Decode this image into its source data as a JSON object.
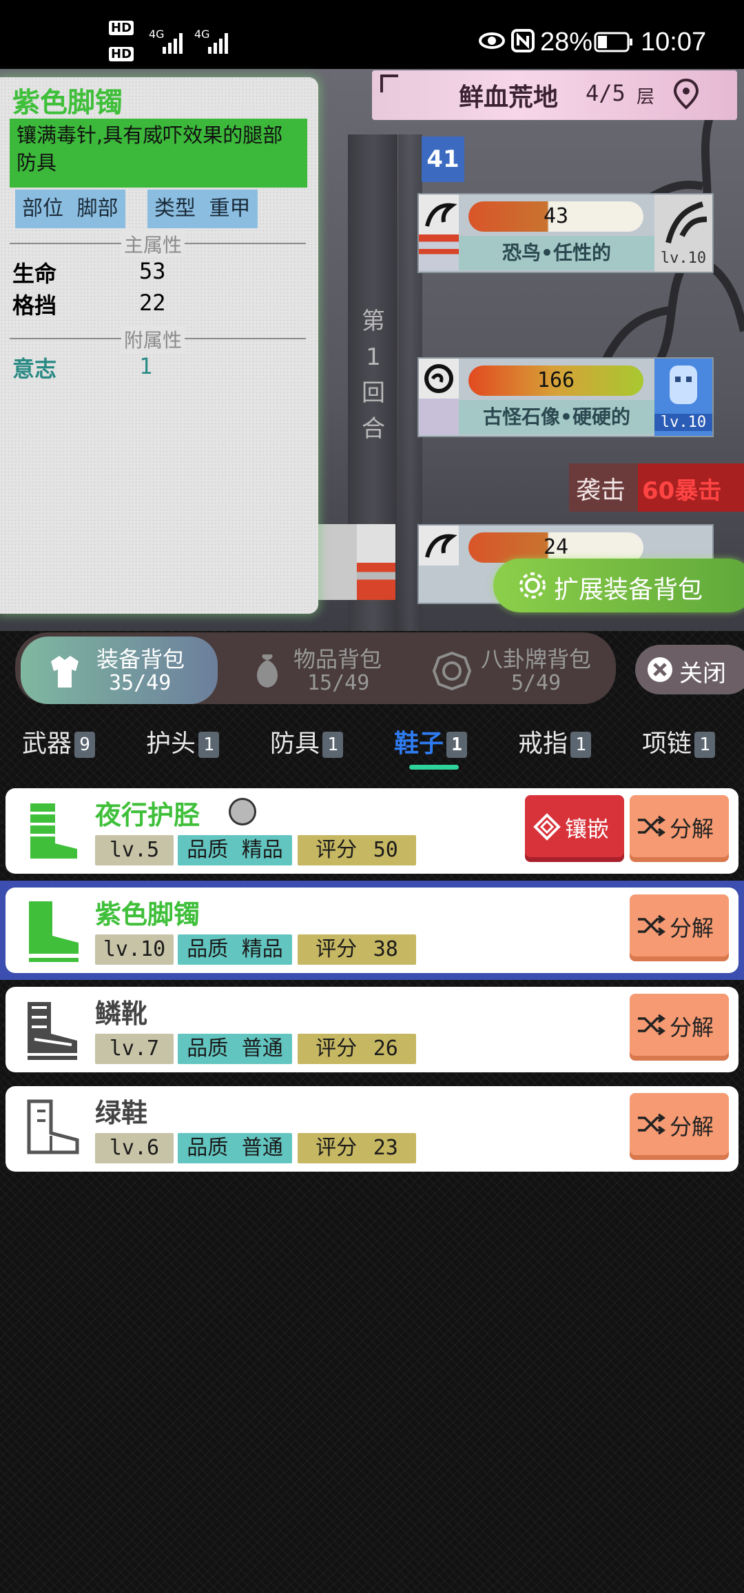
{
  "status_bar": {
    "hd1": "HD",
    "hd2": "HD",
    "net1": "4G",
    "net2": "4G",
    "battery_percent": "28%",
    "time": "10:07"
  },
  "scene": {
    "map_name": "鲜血荒地",
    "floor": "4/5",
    "floor_unit": "层",
    "turn_badge": "41",
    "round_text": "第\n1\n回\n合",
    "enemies": [
      {
        "hp": "43",
        "name": "恐鸟•任性的",
        "level": "lv.10"
      },
      {
        "hp": "166",
        "name": "古怪石像•硬硬的",
        "level": "lv.10"
      },
      {
        "hp": "24",
        "name": "",
        "level": ""
      }
    ],
    "attack_label": "袭击",
    "crit_text": "60暴击",
    "expand_button": "扩展装备背包"
  },
  "tooltip": {
    "title": "紫色脚镯",
    "description": "镶满毒针,具有威吓效果的腿部防具",
    "slot_label": "部位",
    "slot_value": "脚部",
    "type_label": "类型",
    "type_value": "重甲",
    "main_attr_header": "主属性",
    "main_attrs": [
      {
        "name": "生命",
        "value": "53"
      },
      {
        "name": "格挡",
        "value": "22"
      }
    ],
    "sub_attr_header": "附属性",
    "sub_attrs": [
      {
        "name": "意志",
        "value": "1"
      }
    ]
  },
  "bag_tabs": [
    {
      "label": "装备背包",
      "count": "35/49",
      "active": true
    },
    {
      "label": "物品背包",
      "count": "15/49",
      "active": false
    },
    {
      "label": "八卦牌背包",
      "count": "5/49",
      "active": false
    }
  ],
  "close_button": "关闭",
  "categories": [
    {
      "label": "武器",
      "count": "9"
    },
    {
      "label": "护头",
      "count": "1"
    },
    {
      "label": "防具",
      "count": "1"
    },
    {
      "label": "鞋子",
      "count": "1",
      "active": true
    },
    {
      "label": "戒指",
      "count": "1"
    },
    {
      "label": "项链",
      "count": "1"
    }
  ],
  "items": [
    {
      "name": "夜行护胫",
      "level": "lv.5",
      "quality_label": "品质",
      "quality": "精品",
      "score_label": "评分",
      "score": "50",
      "inlay_label": "镶嵌",
      "decompose_label": "分解",
      "icon": "green-greave-icon"
    },
    {
      "name": "紫色脚镯",
      "level": "lv.10",
      "quality_label": "品质",
      "quality": "精品",
      "score_label": "评分",
      "score": "38",
      "decompose_label": "分解",
      "icon": "green-boot-icon",
      "selected": true
    },
    {
      "name": "鳞靴",
      "level": "lv.7",
      "quality_label": "品质",
      "quality": "普通",
      "score_label": "评分",
      "score": "26",
      "decompose_label": "分解",
      "icon": "scale-boot-icon"
    },
    {
      "name": "绿鞋",
      "level": "lv.6",
      "quality_label": "品质",
      "quality": "普通",
      "score_label": "评分",
      "score": "23",
      "decompose_label": "分解",
      "icon": "shoe-icon"
    }
  ],
  "colors": {
    "rare_name": "#3fbf3a",
    "common_name": "#444444",
    "active_tab": "#2f7bf0",
    "tab_underline": "#2fd39a",
    "selected_border": "#3c4fb0"
  }
}
